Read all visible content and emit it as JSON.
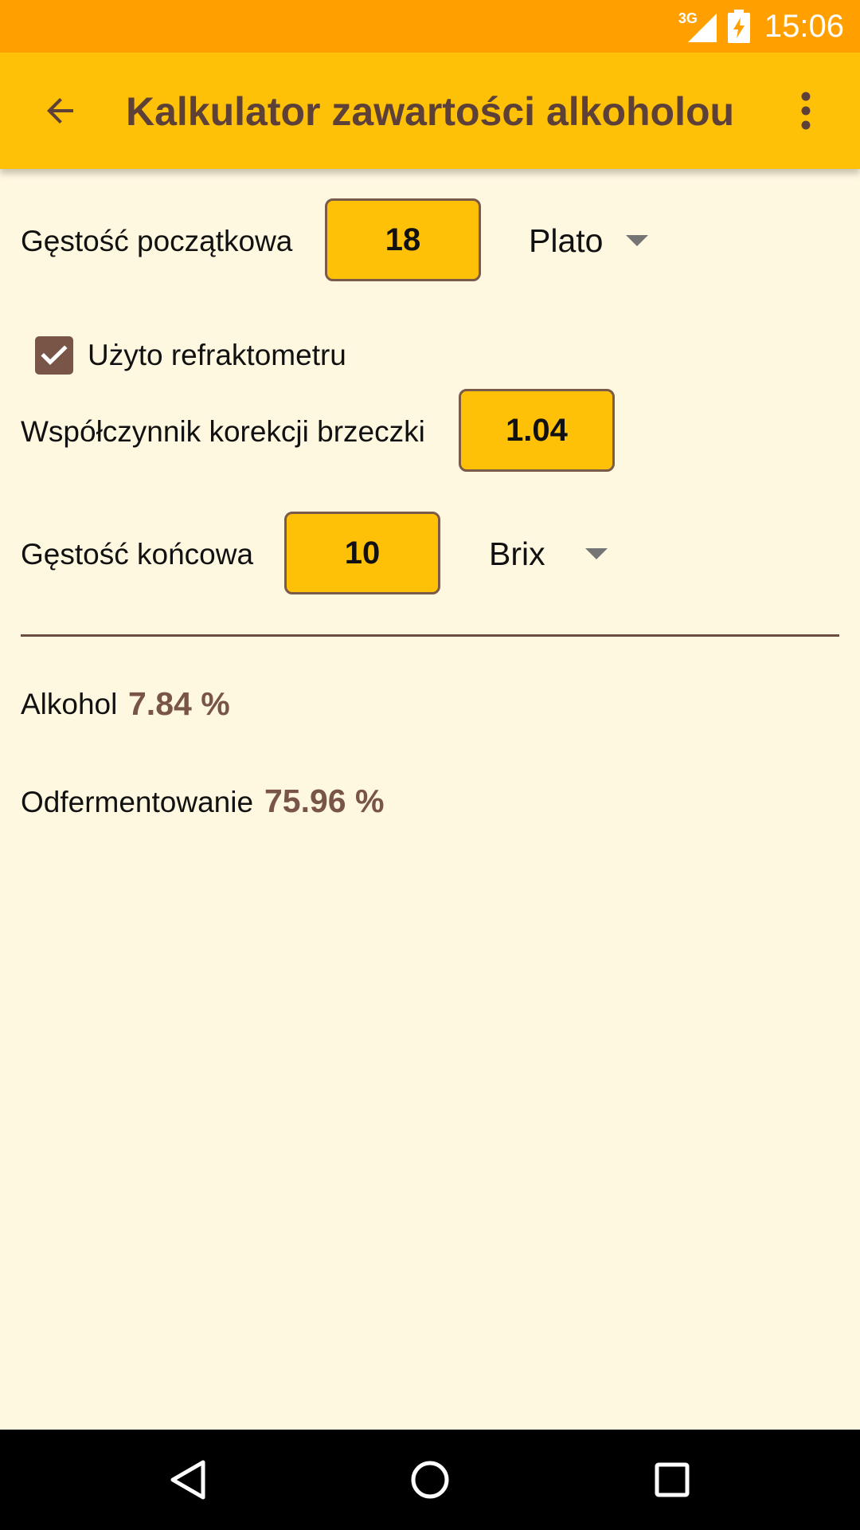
{
  "status_bar": {
    "network": "3G",
    "time": "15:06",
    "icons": [
      "signal-icon",
      "battery-charging-icon"
    ]
  },
  "app_bar": {
    "title": "Kalkulator zawartości alkoholou",
    "icons": [
      "back-arrow-icon",
      "more-vert-icon"
    ]
  },
  "form": {
    "initial_gravity": {
      "label": "Gęstość początkowa",
      "value": "18",
      "unit": "Plato"
    },
    "refractometer": {
      "label": "Użyto refraktometru",
      "checked": true
    },
    "correction": {
      "label": "Współczynnik korekcji brzeczki",
      "value": "1.04"
    },
    "final_gravity": {
      "label": "Gęstość końcowa",
      "value": "10",
      "unit": "Brix"
    }
  },
  "results": {
    "alcohol": {
      "label": "Alkohol",
      "value": "7.84 %"
    },
    "attenuation": {
      "label": "Odfermentowanie",
      "value": "75.96 %"
    }
  },
  "nav_bar": {
    "icons": [
      "back-triangle-icon",
      "home-circle-icon",
      "recents-square-icon"
    ]
  },
  "colors": {
    "status_bar": "#FFA000",
    "app_bar": "#FFC107",
    "title_text": "#5D4037",
    "background": "#FFF8E1",
    "accent": "#795548",
    "field_fill": "#FFC107"
  }
}
